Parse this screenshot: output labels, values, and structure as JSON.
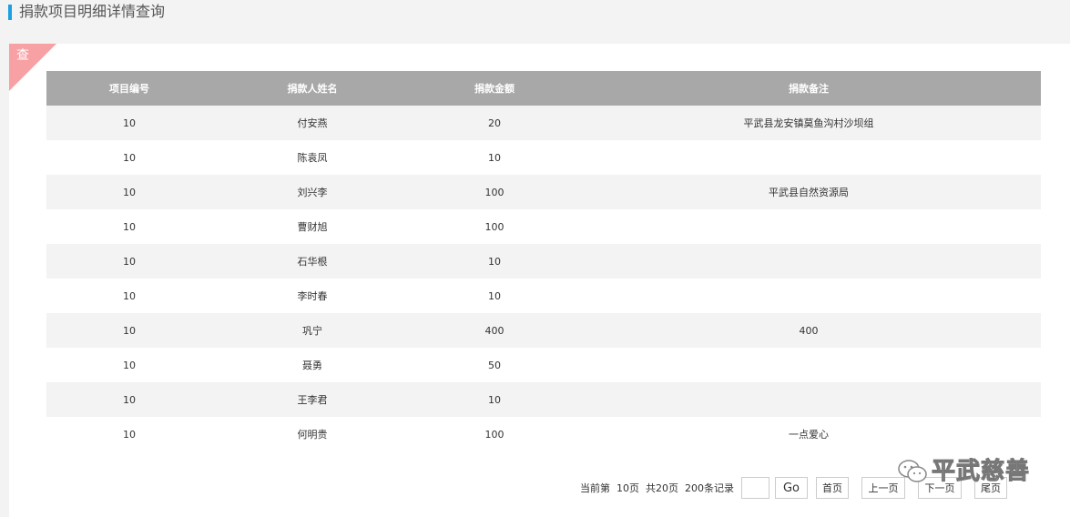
{
  "header": {
    "title": "捐款项目明细详情查询"
  },
  "panel": {
    "tag": "查"
  },
  "table": {
    "columns": [
      "项目编号",
      "捐款人姓名",
      "捐款金额",
      "捐款备注"
    ],
    "rows": [
      [
        "10",
        "付安燕",
        "20",
        "平武县龙安镇莫鱼沟村沙坝组"
      ],
      [
        "10",
        "陈袁凤",
        "10",
        ""
      ],
      [
        "10",
        "刘兴李",
        "100",
        "平武县自然资源局"
      ],
      [
        "10",
        "曹财旭",
        "100",
        ""
      ],
      [
        "10",
        "石华根",
        "10",
        ""
      ],
      [
        "10",
        "李时春",
        "10",
        ""
      ],
      [
        "10",
        "巩宁",
        "400",
        "400"
      ],
      [
        "10",
        "聂勇",
        "50",
        ""
      ],
      [
        "10",
        "王李君",
        "10",
        ""
      ],
      [
        "10",
        "何明贵",
        "100",
        "一点爱心"
      ]
    ]
  },
  "pager": {
    "info": "当前第  10页  共20页  200条记录",
    "input_value": "",
    "go_label": "Go",
    "first_label": "首页",
    "prev_label": "上一页",
    "next_label": "下一页",
    "last_label": "尾页"
  },
  "watermark": {
    "text": "平武慈善",
    "icon": "wechat-icon"
  }
}
